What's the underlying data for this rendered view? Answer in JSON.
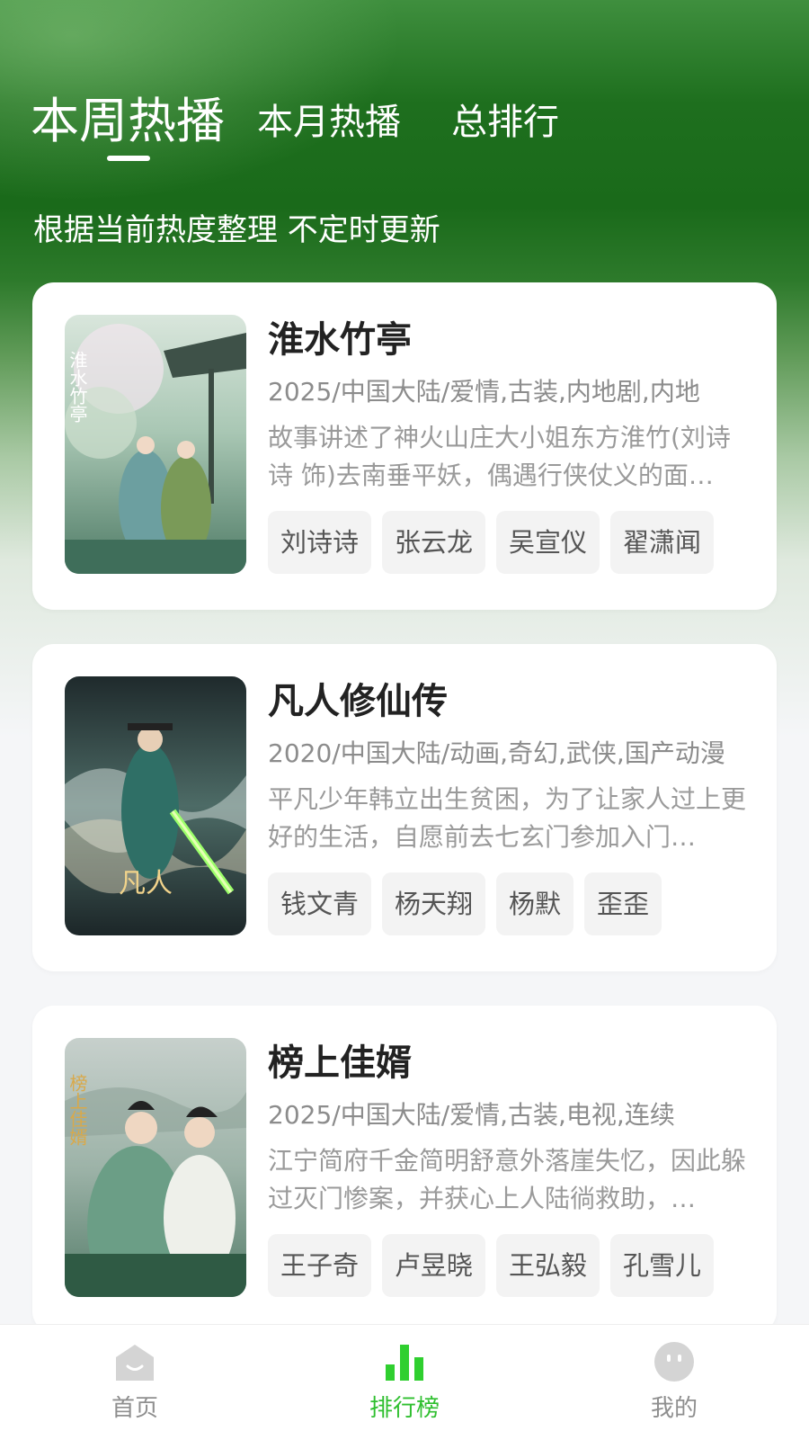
{
  "tabs": [
    {
      "label": "本周热播",
      "active": true
    },
    {
      "label": "本月热播",
      "active": false
    },
    {
      "label": "总排行",
      "active": false
    }
  ],
  "subtitle": "根据当前热度整理 不定时更新",
  "items": [
    {
      "title": "淮水竹亭",
      "meta": "2025/中国大陆/爱情,古装,内地剧,内地",
      "desc": "故事讲述了神火山庄大小姐东方淮竹(刘诗诗 饰)去南垂平妖，偶遇行侠仗义的面…",
      "cast": [
        "刘诗诗",
        "张云龙",
        "吴宣仪",
        "翟潇闻"
      ],
      "poster_title": "淮水竹亭",
      "poster_colors": [
        "#bfd6c6",
        "#5f8a72",
        "#2e5a4a"
      ]
    },
    {
      "title": "凡人修仙传",
      "meta": "2020/中国大陆/动画,奇幻,武侠,国产动漫",
      "desc": "平凡少年韩立出生贫困，为了让家人过上更好的生活，自愿前去七玄门参加入门…",
      "cast": [
        "钱文青",
        "杨天翔",
        "杨默",
        "歪歪"
      ],
      "poster_title": "凡人",
      "poster_colors": [
        "#2b3a3a",
        "#3f6a60",
        "#c8b27a"
      ]
    },
    {
      "title": "榜上佳婿",
      "meta": "2025/中国大陆/爱情,古装,电视,连续",
      "desc": "江宁简府千金简明舒意外落崖失忆，因此躲过灭门惨案，并获心上人陆徜救助，…",
      "cast": [
        "王子奇",
        "卢昱晓",
        "王弘毅",
        "孔雪儿"
      ],
      "poster_title": "榜上佳婿",
      "poster_colors": [
        "#a9b9b2",
        "#5e8a78",
        "#c9a266"
      ]
    }
  ],
  "nav": [
    {
      "label": "首页",
      "icon": "home-icon",
      "active": false
    },
    {
      "label": "排行榜",
      "icon": "bar-chart-icon",
      "active": true
    },
    {
      "label": "我的",
      "icon": "profile-icon",
      "active": false
    }
  ],
  "colors": {
    "accent": "#2fbf2f",
    "hero_green": "#1e6f1e"
  }
}
